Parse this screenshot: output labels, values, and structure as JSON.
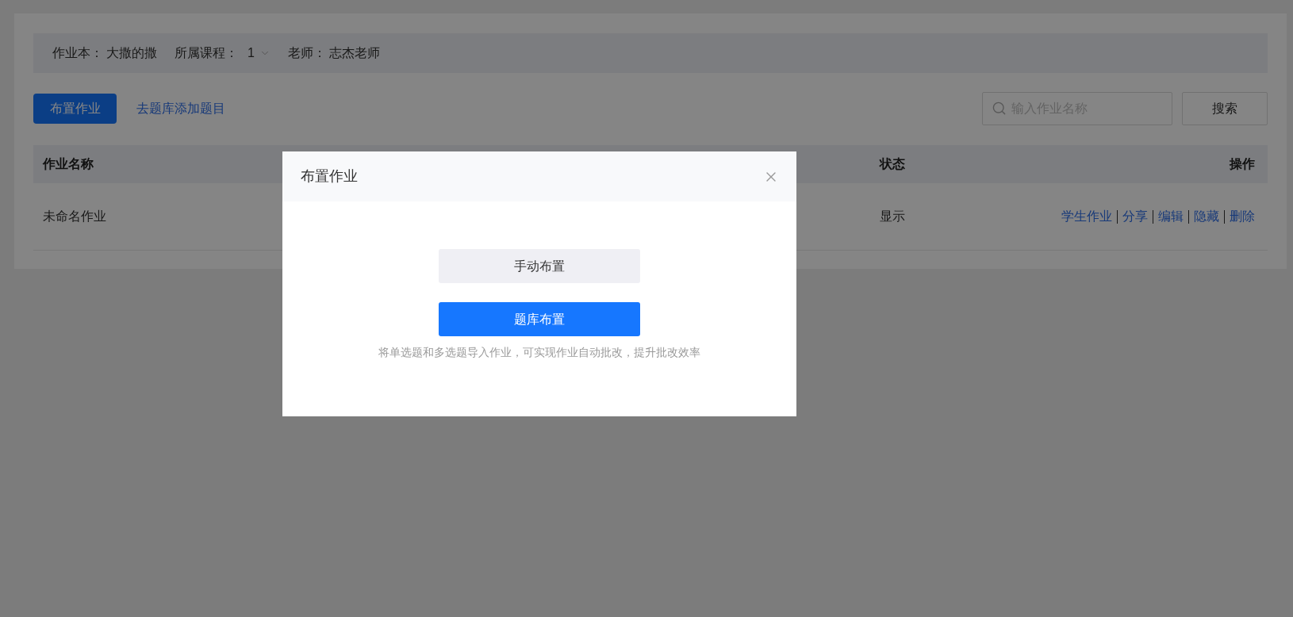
{
  "info_bar": [
    {
      "kind": "text",
      "label": "作业本：",
      "value": "大撒的撒"
    },
    {
      "kind": "select",
      "label": "所属课程：",
      "value": "1"
    },
    {
      "kind": "text",
      "label": "老师：",
      "value": "志杰老师"
    }
  ],
  "toolbar": {
    "primary_button": "布置作业",
    "link": "去题库添加题目",
    "search": {
      "placeholder": "输入作业名称"
    },
    "search_button": "搜索"
  },
  "table": {
    "columns": [
      "作业名称",
      "状态",
      "操作"
    ],
    "rows": [
      {
        "name": "未命名作业",
        "status": "显示",
        "actions": [
          "学生作业",
          "分享",
          "编辑",
          "隐藏",
          "删除"
        ]
      }
    ]
  },
  "dialog": {
    "title": "布置作业",
    "buttons": [
      {
        "kind": "secondary",
        "label": "手动布置"
      },
      {
        "kind": "primary",
        "label": "题库布置"
      }
    ],
    "hint": "将单选题和多选题导入作业，可实现作业自动批改，提升批改效率"
  }
}
